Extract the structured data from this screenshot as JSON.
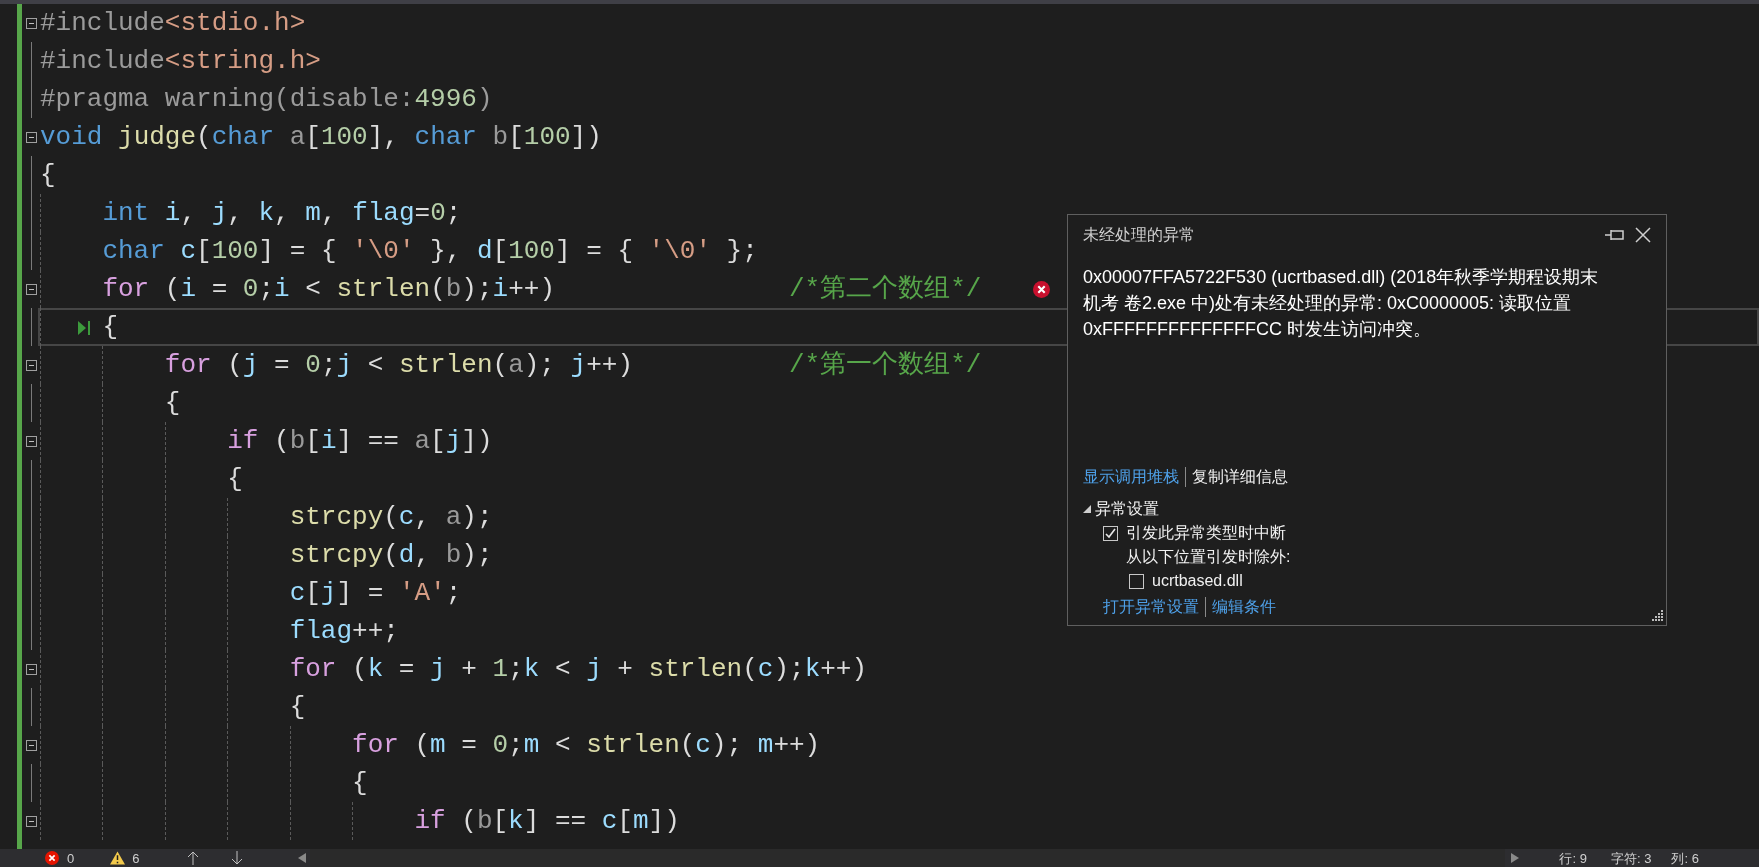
{
  "editor": {
    "lines": [
      {
        "fold": true,
        "tokens": [
          {
            "kind": "pp",
            "text": "#include"
          },
          {
            "kind": "inc",
            "text": "<stdio.h>"
          }
        ]
      },
      {
        "fold": false,
        "tokens": [
          {
            "kind": "pp",
            "text": "#include"
          },
          {
            "kind": "inc",
            "text": "<string.h>"
          }
        ]
      },
      {
        "fold": false,
        "tokens": [
          {
            "kind": "pp",
            "text": "#pragma warning(disable:"
          },
          {
            "kind": "num",
            "text": "4996"
          },
          {
            "kind": "pp",
            "text": ")"
          }
        ]
      },
      {
        "fold": true,
        "tokens": [
          {
            "kind": "kw",
            "text": "void"
          },
          {
            "kind": "fn",
            "text": " judge"
          },
          {
            "kind": "p",
            "text": "("
          },
          {
            "kind": "kw",
            "text": "char"
          },
          {
            "kind": "prm",
            "text": " a"
          },
          {
            "kind": "p",
            "text": "["
          },
          {
            "kind": "num",
            "text": "100"
          },
          {
            "kind": "p",
            "text": "], "
          },
          {
            "kind": "kw",
            "text": "char"
          },
          {
            "kind": "prm",
            "text": " b"
          },
          {
            "kind": "p",
            "text": "["
          },
          {
            "kind": "num",
            "text": "100"
          },
          {
            "kind": "p",
            "text": "])"
          }
        ]
      },
      {
        "fold": false,
        "tokens": [
          {
            "kind": "p",
            "text": "{"
          }
        ]
      },
      {
        "fold": false,
        "tokens": [
          {
            "kind": "kw",
            "text": "    int"
          },
          {
            "kind": "var",
            "text": " i"
          },
          {
            "kind": "p",
            "text": ", "
          },
          {
            "kind": "var",
            "text": "j"
          },
          {
            "kind": "p",
            "text": ", "
          },
          {
            "kind": "var",
            "text": "k"
          },
          {
            "kind": "p",
            "text": ", "
          },
          {
            "kind": "var",
            "text": "m"
          },
          {
            "kind": "p",
            "text": ", "
          },
          {
            "kind": "var",
            "text": "flag"
          },
          {
            "kind": "p",
            "text": "="
          },
          {
            "kind": "num",
            "text": "0"
          },
          {
            "kind": "p",
            "text": ";"
          }
        ]
      },
      {
        "fold": false,
        "tokens": [
          {
            "kind": "kw",
            "text": "    char"
          },
          {
            "kind": "var",
            "text": " c"
          },
          {
            "kind": "p",
            "text": "["
          },
          {
            "kind": "num",
            "text": "100"
          },
          {
            "kind": "p",
            "text": "] = { "
          },
          {
            "kind": "str",
            "text": "'\\0'"
          },
          {
            "kind": "p",
            "text": " }, "
          },
          {
            "kind": "var",
            "text": "d"
          },
          {
            "kind": "p",
            "text": "["
          },
          {
            "kind": "num",
            "text": "100"
          },
          {
            "kind": "p",
            "text": "] = { "
          },
          {
            "kind": "str",
            "text": "'\\0'"
          },
          {
            "kind": "p",
            "text": " };"
          }
        ]
      },
      {
        "fold": true,
        "error": true,
        "comment": "/*第二个数组*/",
        "tokens": [
          {
            "kind": "ctl",
            "text": "    for"
          },
          {
            "kind": "p",
            "text": " ("
          },
          {
            "kind": "var",
            "text": "i"
          },
          {
            "kind": "p",
            "text": " = "
          },
          {
            "kind": "num",
            "text": "0"
          },
          {
            "kind": "p",
            "text": ";"
          },
          {
            "kind": "var",
            "text": "i"
          },
          {
            "kind": "p",
            "text": " < "
          },
          {
            "kind": "fn",
            "text": "strlen"
          },
          {
            "kind": "p",
            "text": "("
          },
          {
            "kind": "prm",
            "text": "b"
          },
          {
            "kind": "p",
            "text": ");"
          },
          {
            "kind": "var",
            "text": "i"
          },
          {
            "kind": "p",
            "text": "++)"
          }
        ]
      },
      {
        "fold": false,
        "current": true,
        "tokens": [
          {
            "kind": "p",
            "text": "    {"
          }
        ]
      },
      {
        "fold": true,
        "comment": "/*第一个数组*/",
        "tokens": [
          {
            "kind": "ctl",
            "text": "        for"
          },
          {
            "kind": "p",
            "text": " ("
          },
          {
            "kind": "var",
            "text": "j"
          },
          {
            "kind": "p",
            "text": " = "
          },
          {
            "kind": "num",
            "text": "0"
          },
          {
            "kind": "p",
            "text": ";"
          },
          {
            "kind": "var",
            "text": "j"
          },
          {
            "kind": "p",
            "text": " < "
          },
          {
            "kind": "fn",
            "text": "strlen"
          },
          {
            "kind": "p",
            "text": "("
          },
          {
            "kind": "prm",
            "text": "a"
          },
          {
            "kind": "p",
            "text": "); "
          },
          {
            "kind": "var",
            "text": "j"
          },
          {
            "kind": "p",
            "text": "++)"
          }
        ]
      },
      {
        "fold": false,
        "tokens": [
          {
            "kind": "p",
            "text": "        {"
          }
        ]
      },
      {
        "fold": true,
        "tokens": [
          {
            "kind": "ctl",
            "text": "            if"
          },
          {
            "kind": "p",
            "text": " ("
          },
          {
            "kind": "prm",
            "text": "b"
          },
          {
            "kind": "p",
            "text": "["
          },
          {
            "kind": "var",
            "text": "i"
          },
          {
            "kind": "p",
            "text": "] == "
          },
          {
            "kind": "prm",
            "text": "a"
          },
          {
            "kind": "p",
            "text": "["
          },
          {
            "kind": "var",
            "text": "j"
          },
          {
            "kind": "p",
            "text": "])"
          }
        ]
      },
      {
        "fold": false,
        "tokens": [
          {
            "kind": "p",
            "text": "            {"
          }
        ]
      },
      {
        "fold": false,
        "tokens": [
          {
            "kind": "fn",
            "text": "                strcpy"
          },
          {
            "kind": "p",
            "text": "("
          },
          {
            "kind": "var",
            "text": "c"
          },
          {
            "kind": "p",
            "text": ", "
          },
          {
            "kind": "prm",
            "text": "a"
          },
          {
            "kind": "p",
            "text": ");"
          }
        ]
      },
      {
        "fold": false,
        "tokens": [
          {
            "kind": "fn",
            "text": "                strcpy"
          },
          {
            "kind": "p",
            "text": "("
          },
          {
            "kind": "var",
            "text": "d"
          },
          {
            "kind": "p",
            "text": ", "
          },
          {
            "kind": "prm",
            "text": "b"
          },
          {
            "kind": "p",
            "text": ");"
          }
        ]
      },
      {
        "fold": false,
        "tokens": [
          {
            "kind": "var",
            "text": "                c"
          },
          {
            "kind": "p",
            "text": "["
          },
          {
            "kind": "var",
            "text": "j"
          },
          {
            "kind": "p",
            "text": "] = "
          },
          {
            "kind": "str",
            "text": "'A'"
          },
          {
            "kind": "p",
            "text": ";"
          }
        ]
      },
      {
        "fold": false,
        "tokens": [
          {
            "kind": "var",
            "text": "                flag"
          },
          {
            "kind": "p",
            "text": "++;"
          }
        ]
      },
      {
        "fold": true,
        "tokens": [
          {
            "kind": "ctl",
            "text": "                for"
          },
          {
            "kind": "p",
            "text": " ("
          },
          {
            "kind": "var",
            "text": "k"
          },
          {
            "kind": "p",
            "text": " = "
          },
          {
            "kind": "var",
            "text": "j"
          },
          {
            "kind": "p",
            "text": " + "
          },
          {
            "kind": "num",
            "text": "1"
          },
          {
            "kind": "p",
            "text": ";"
          },
          {
            "kind": "var",
            "text": "k"
          },
          {
            "kind": "p",
            "text": " < "
          },
          {
            "kind": "var",
            "text": "j"
          },
          {
            "kind": "p",
            "text": " + "
          },
          {
            "kind": "fn",
            "text": "strlen"
          },
          {
            "kind": "p",
            "text": "("
          },
          {
            "kind": "var",
            "text": "c"
          },
          {
            "kind": "p",
            "text": ");"
          },
          {
            "kind": "var",
            "text": "k"
          },
          {
            "kind": "p",
            "text": "++)"
          }
        ]
      },
      {
        "fold": false,
        "tokens": [
          {
            "kind": "p",
            "text": "                {"
          }
        ]
      },
      {
        "fold": true,
        "tokens": [
          {
            "kind": "ctl",
            "text": "                    for"
          },
          {
            "kind": "p",
            "text": " ("
          },
          {
            "kind": "var",
            "text": "m"
          },
          {
            "kind": "p",
            "text": " = "
          },
          {
            "kind": "num",
            "text": "0"
          },
          {
            "kind": "p",
            "text": ";"
          },
          {
            "kind": "var",
            "text": "m"
          },
          {
            "kind": "p",
            "text": " < "
          },
          {
            "kind": "fn",
            "text": "strlen"
          },
          {
            "kind": "p",
            "text": "("
          },
          {
            "kind": "var",
            "text": "c"
          },
          {
            "kind": "p",
            "text": "); "
          },
          {
            "kind": "var",
            "text": "m"
          },
          {
            "kind": "p",
            "text": "++)"
          }
        ]
      },
      {
        "fold": false,
        "tokens": [
          {
            "kind": "p",
            "text": "                    {"
          }
        ]
      },
      {
        "fold": true,
        "tokens": [
          {
            "kind": "ctl",
            "text": "                        if"
          },
          {
            "kind": "p",
            "text": " ("
          },
          {
            "kind": "prm",
            "text": "b"
          },
          {
            "kind": "p",
            "text": "["
          },
          {
            "kind": "var",
            "text": "k"
          },
          {
            "kind": "p",
            "text": "] == "
          },
          {
            "kind": "var",
            "text": "c"
          },
          {
            "kind": "p",
            "text": "["
          },
          {
            "kind": "var",
            "text": "m"
          },
          {
            "kind": "p",
            "text": "])"
          }
        ]
      }
    ]
  },
  "exception_popup": {
    "title": "未经处理的异常",
    "message": "0x00007FFA5722F530 (ucrtbased.dll) (2018年秋季学期程设期末机考 卷2.exe 中)处有未经处理的异常: 0xC0000005: 读取位置 0xFFFFFFFFFFFFFFCC 时发生访问冲突。",
    "actions": [
      {
        "label": "显示调用堆栈",
        "kind": "link"
      },
      {
        "label": "复制详细信息",
        "kind": "plain"
      }
    ],
    "settings": {
      "label": "异常设置",
      "expanded": true,
      "options": [
        {
          "kind": "checkbox",
          "label": "引发此异常类型时中断",
          "checked": true,
          "nested": false
        },
        {
          "kind": "note",
          "label": "从以下位置引发时除外:"
        },
        {
          "kind": "checkbox",
          "label": "ucrtbased.dll",
          "checked": false,
          "nested": true
        }
      ],
      "links": [
        "打开异常设置",
        "编辑条件"
      ]
    }
  },
  "status_bar": {
    "errors": "0",
    "warnings": "6",
    "line": "行: 9",
    "char": "字符: 3",
    "col": "列: 6"
  }
}
